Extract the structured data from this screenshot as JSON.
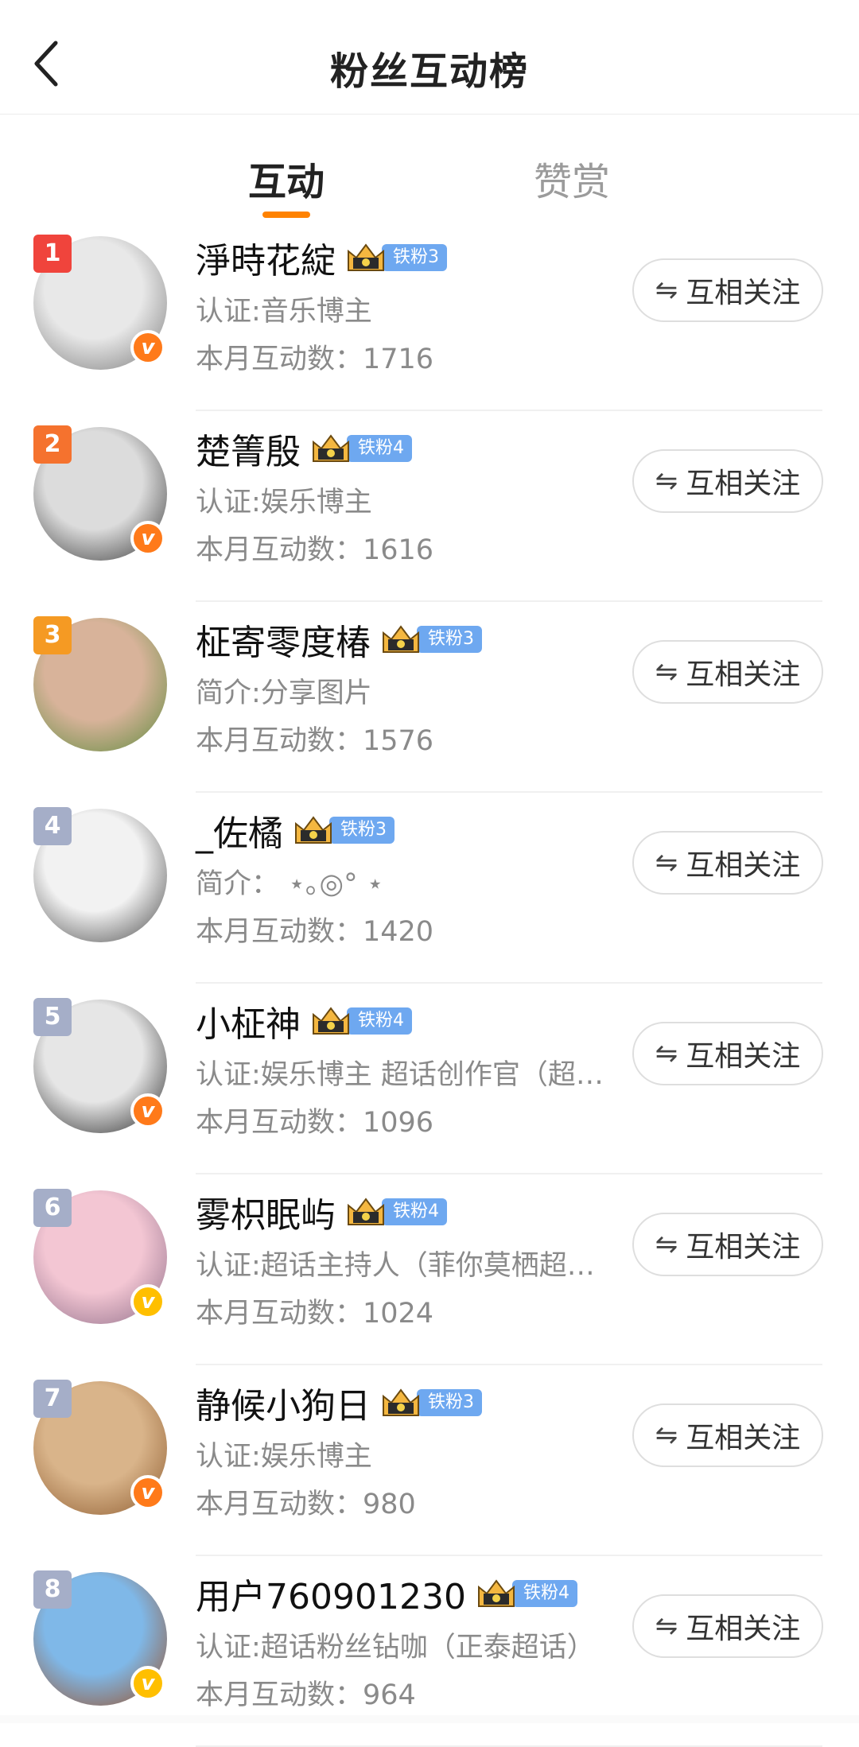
{
  "header": {
    "title": "粉丝互动榜",
    "back_icon": "chevron-left-icon"
  },
  "tabs": [
    {
      "label": "互动",
      "active": true
    },
    {
      "label": "赞赏",
      "active": false
    }
  ],
  "follow_label": "互相关注",
  "follow_icon": "swap-arrows-icon",
  "items": [
    {
      "rank": "1",
      "rank_color": "#f0443c",
      "name": "淨時花綻",
      "fan_badge": "铁粉3",
      "crown_level": "1",
      "desc": "认证:音乐博主",
      "count": "本月互动数：1716",
      "verified": "#ff7a1a",
      "avatar_colors": [
        "#e8e8e8",
        "#777777"
      ]
    },
    {
      "rank": "2",
      "rank_color": "#f5722e",
      "name": "楚箐殷",
      "fan_badge": "铁粉4",
      "crown_level": "1",
      "desc": "认证:娱乐博主",
      "count": "本月互动数：1616",
      "verified": "#ff7a1a",
      "avatar_colors": [
        "#dcdcdc",
        "#333333"
      ]
    },
    {
      "rank": "3",
      "rank_color": "#f59a23",
      "name": "柾寄零度椿",
      "fan_badge": "铁粉3",
      "crown_level": "5",
      "desc": "简介:分享图片",
      "count": "本月互动数：1576",
      "verified": "",
      "avatar_colors": [
        "#d8b39a",
        "#5c8a3c"
      ]
    },
    {
      "rank": "4",
      "rank_color": "#a5aec8",
      "name": "_佐橘",
      "fan_badge": "铁粉3",
      "crown_level": "5",
      "desc": "简介：  ⋆｡◎°  ⋆",
      "count": "本月互动数：1420",
      "verified": "",
      "avatar_colors": [
        "#f2f2f2",
        "#444444"
      ]
    },
    {
      "rank": "5",
      "rank_color": "#a5aec8",
      "name": "小柾神",
      "fan_badge": "铁粉4",
      "crown_level": "1",
      "desc": "认证:娱乐博主 超话创作官（超话…",
      "count": "本月互动数：1096",
      "verified": "#ff7a1a",
      "avatar_colors": [
        "#e6e6e6",
        "#222222"
      ]
    },
    {
      "rank": "6",
      "rank_color": "#a5aec8",
      "name": "雾枳眠屿",
      "fan_badge": "铁粉4",
      "crown_level": "5",
      "desc": "认证:超话主持人（菲你莫栖超话）",
      "count": "本月互动数：1024",
      "verified": "#ffbf00",
      "avatar_colors": [
        "#f3c6d3",
        "#8c6b86"
      ]
    },
    {
      "rank": "7",
      "rank_color": "#a5aec8",
      "name": "静候小狗日",
      "fan_badge": "铁粉3",
      "crown_level": "1",
      "desc": "认证:娱乐博主",
      "count": "本月互动数：980",
      "verified": "#ff7a1a",
      "avatar_colors": [
        "#d9b48a",
        "#8c5a2e"
      ]
    },
    {
      "rank": "8",
      "rank_color": "#a5aec8",
      "name": "用户760901230",
      "fan_badge": "铁粉4",
      "crown_level": "5",
      "desc": "认证:超话粉丝钻咖（正泰超话）",
      "count": "本月互动数：964",
      "verified": "#ffbf00",
      "avatar_colors": [
        "#7fb8e8",
        "#9a4b1e"
      ]
    }
  ]
}
